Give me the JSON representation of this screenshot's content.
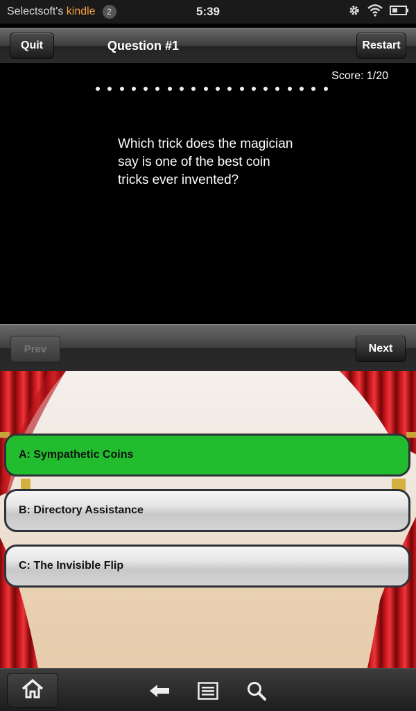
{
  "status_bar": {
    "owner_prefix": "Selectsoft's ",
    "owner_brand": "kindle",
    "notification_count": "2",
    "time": "5:39",
    "icons": [
      "gear-icon",
      "wifi-icon",
      "battery-icon"
    ]
  },
  "toolbar": {
    "quit_label": "Quit",
    "title": "Question #1",
    "restart_label": "Restart"
  },
  "quiz": {
    "score": "Score: 1/20",
    "progress_dot_count": 20,
    "question": "Which trick does the magician say is one of the best coin tricks ever invented?"
  },
  "nav": {
    "prev_label": "Prev",
    "next_label": "Next"
  },
  "answers": [
    {
      "label": "A: Sympathetic Coins",
      "selected": true
    },
    {
      "label": "B: Directory Assistance",
      "selected": false
    },
    {
      "label": "C: The Invisible Flip",
      "selected": false
    }
  ],
  "colors": {
    "selected_answer": "#22bd2f",
    "brand_accent": "#f0a03c",
    "curtain_red": "#c8141a"
  },
  "bottom_bar": {
    "icons": [
      "home-icon",
      "back-arrow-icon",
      "menu-icon",
      "search-icon"
    ]
  }
}
